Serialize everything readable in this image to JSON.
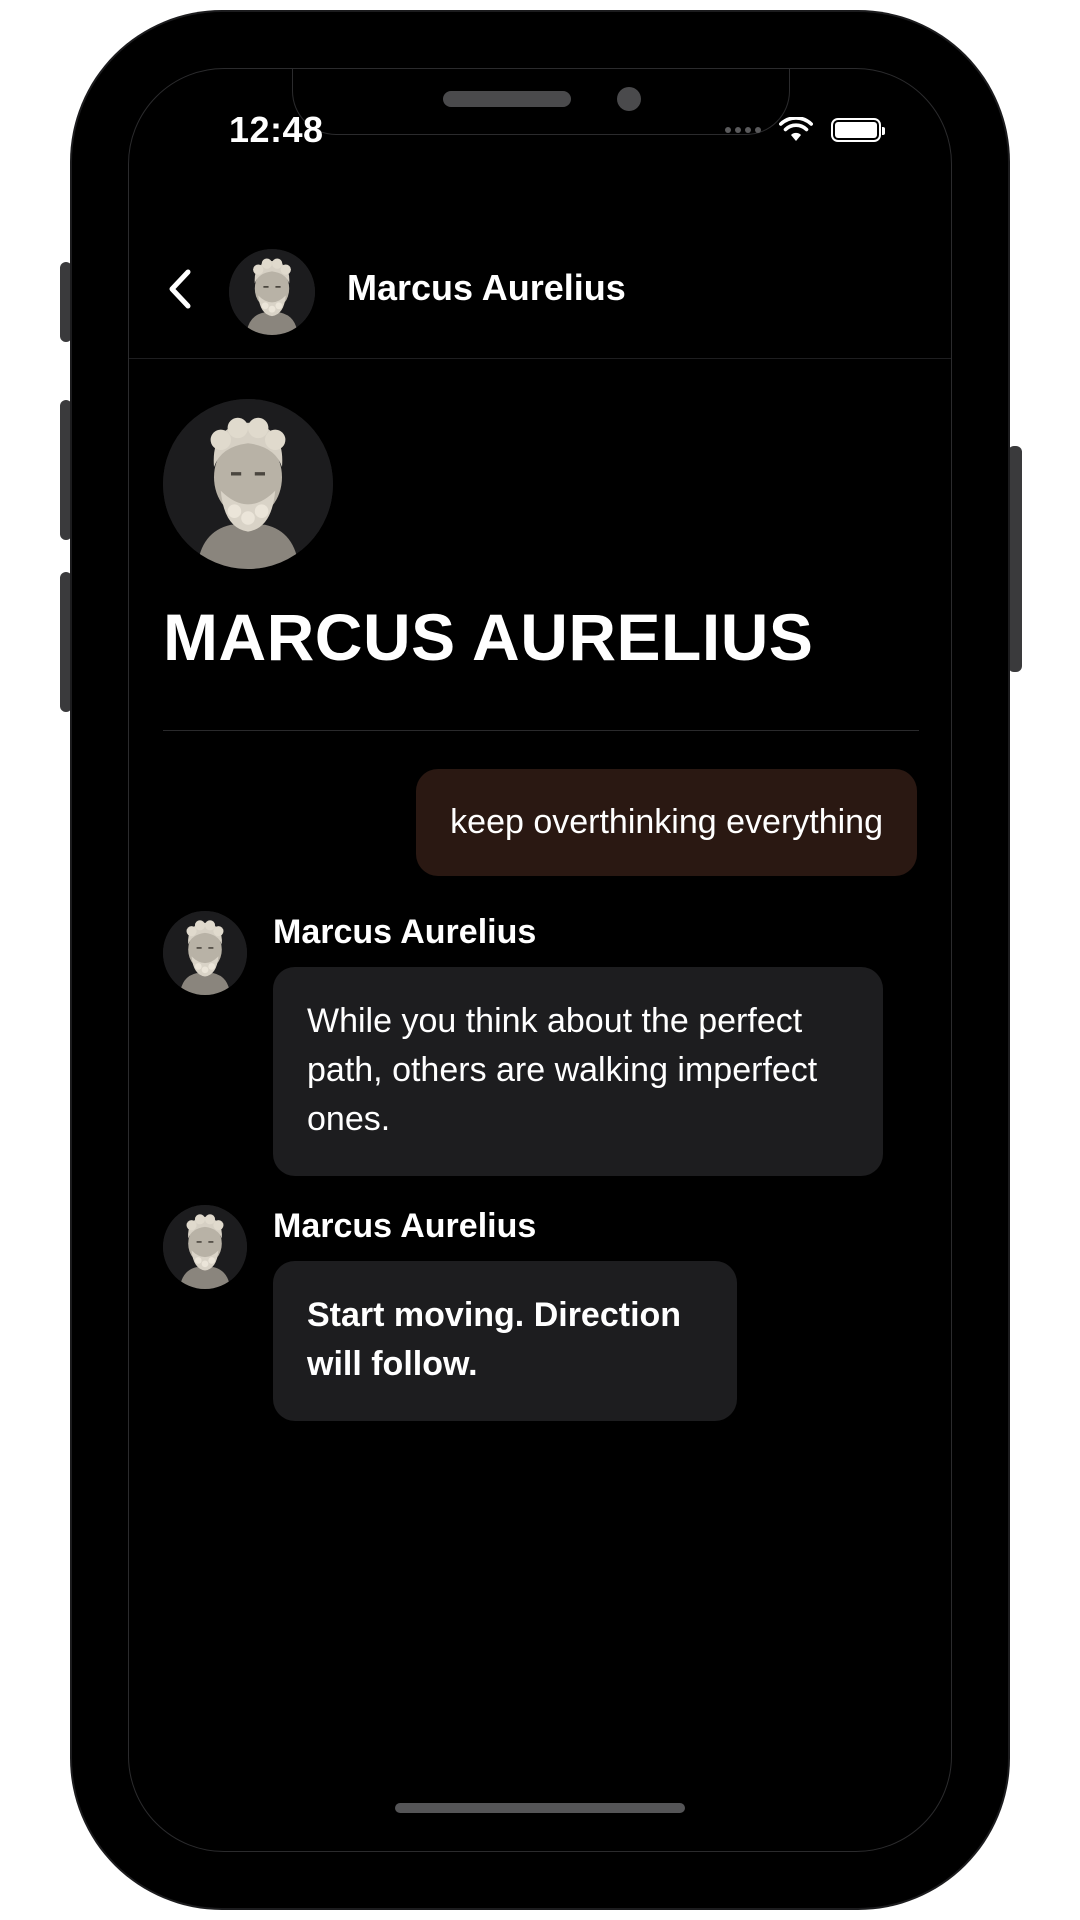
{
  "status_bar": {
    "time": "12:48"
  },
  "header": {
    "back_icon": "chevron-left-icon",
    "contact_name": "Marcus Aurelius"
  },
  "profile": {
    "name": "MARCUS AURELIUS"
  },
  "messages": [
    {
      "from": "user",
      "text": "keep overthinking everything"
    },
    {
      "from": "bot",
      "sender": "Marcus Aurelius",
      "text": "While you think about the perfect path, others are walking imperfect ones."
    },
    {
      "from": "bot",
      "sender": "Marcus Aurelius",
      "text": "Start moving. Direction will follow."
    }
  ],
  "colors": {
    "background": "#000000",
    "user_bubble": "#2a1812",
    "bot_bubble": "#1d1d1f",
    "text": "#ffffff"
  }
}
